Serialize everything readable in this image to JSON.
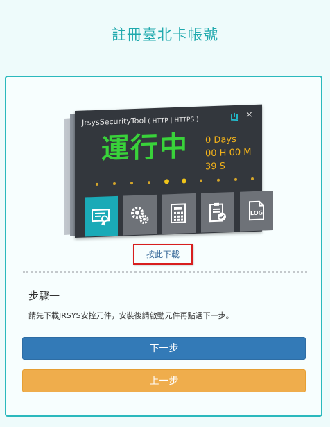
{
  "page": {
    "title": "註冊臺北卡帳號"
  },
  "tool": {
    "app_name": "JrsysSecurityTool",
    "protocols": "( HTTP | HTTPS )",
    "close_glyph": "×",
    "status": "運行中",
    "uptime_days": "0 Days",
    "uptime_time": "00 H 00 M 39 S",
    "tiles": [
      {
        "icon": "certificate-icon",
        "active": true
      },
      {
        "icon": "gears-icon",
        "active": false
      },
      {
        "icon": "calculator-icon",
        "active": false
      },
      {
        "icon": "clipboard-check-icon",
        "active": false
      },
      {
        "icon": "log-file-icon",
        "active": false
      }
    ],
    "log_label": "LOG",
    "colors": {
      "status": "#39d23a",
      "timer": "#f2b21a",
      "active_tile": "#1aaab7",
      "window": "#33373d"
    }
  },
  "download": {
    "label": "按此下載",
    "highlight": "#d81e1e"
  },
  "step": {
    "title": "步驟一",
    "description": "請先下載JRSYS安控元件，安裝後請啟動元件再點選下一步。"
  },
  "buttons": {
    "next": "下一步",
    "prev": "上一步"
  },
  "colors": {
    "accent": "#1fa9ad",
    "primary": "#337ab7",
    "warning": "#efad4c"
  }
}
